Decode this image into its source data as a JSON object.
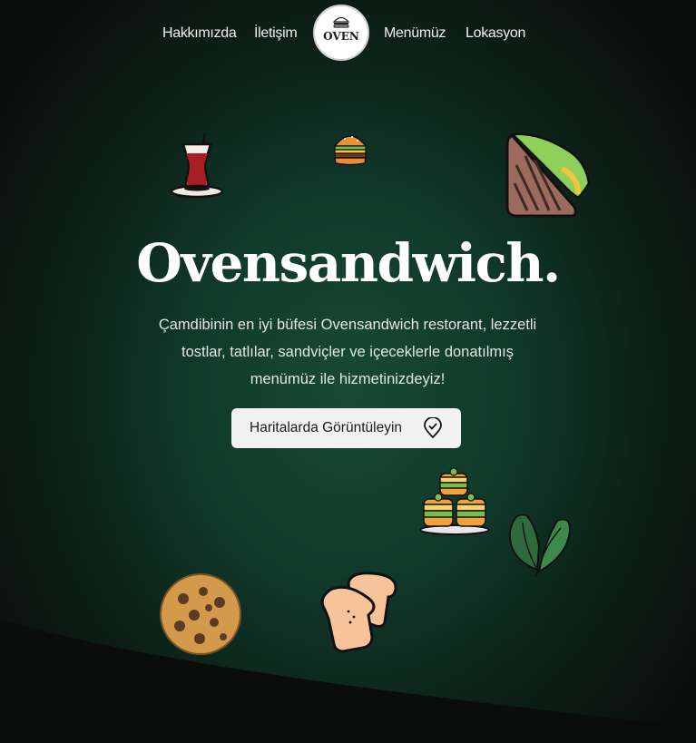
{
  "nav": {
    "links": [
      "Hakkımızda",
      "İletişim",
      "Menümüz",
      "Lokasyon"
    ],
    "logo_text": "OVEN"
  },
  "hero": {
    "title": "Ovensandwich.",
    "description": "Çamdibinin en iyi büfesi Ovensandwich restorant, lezzetli tostlar, tatlılar, sandviçler ve içeceklerle donatılmış menümüz ile hizmetinizdeyiz!",
    "cta_label": "Haritalarda Görüntüleyin"
  },
  "icons": [
    "turkish-tea-icon",
    "burger-icon",
    "sandwich-icon",
    "baklava-icon",
    "spinach-leaf-icon",
    "cookie-icon",
    "bread-slices-icon",
    "map-pin-check-icon"
  ],
  "colors": {
    "background": "#0b0c0c",
    "hero_green": "#184b33",
    "button_bg": "#f2f2f2",
    "text": "#ffffff"
  }
}
